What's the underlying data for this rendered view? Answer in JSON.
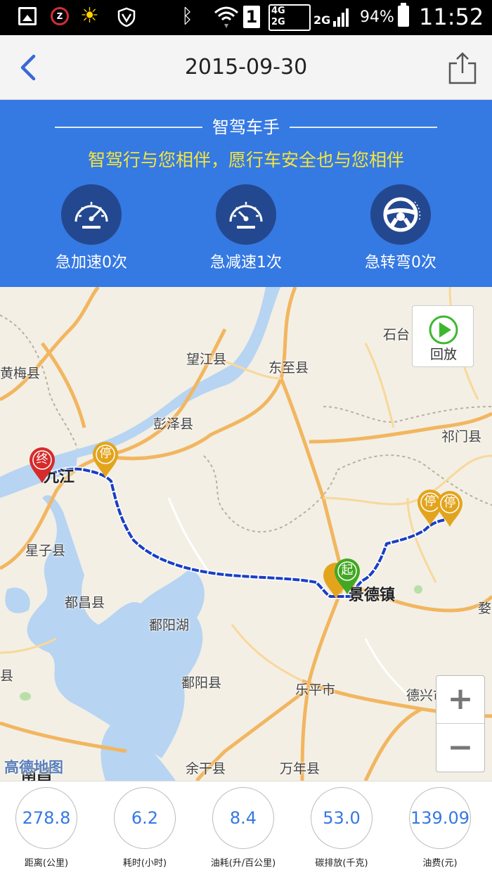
{
  "status_bar": {
    "sim_slot": "1",
    "network_4g": "4G",
    "network_2g_top": "2G",
    "network_2g": "2G",
    "battery_percent": "94%",
    "time": "11:52",
    "zapp_letter": "Z"
  },
  "header": {
    "title": "2015-09-30"
  },
  "banner": {
    "title": "智驾车手",
    "slogan": "智驾行与您相伴，愿行车安全也与您相伴",
    "stats": [
      {
        "label": "急加速0次",
        "icon": "speedometer-icon"
      },
      {
        "label": "急减速1次",
        "icon": "speedometer-icon"
      },
      {
        "label": "急转弯0次",
        "icon": "steering-wheel-icon"
      }
    ]
  },
  "map": {
    "replay_label": "回放",
    "zoom_in": "+",
    "zoom_out": "−",
    "logo": "高德地图",
    "labels": {
      "huangmei": "黄梅县",
      "wangjiang": "望江县",
      "dongzhi": "东至县",
      "shitai": "石台",
      "pengze": "彭泽县",
      "qimen": "祁门县",
      "jiujiang": "九江",
      "xingzi": "星子县",
      "duchang": "都昌县",
      "jingdezhen": "景德镇",
      "poyanghu": "鄱阳湖",
      "poyang": "鄱阳县",
      "leping": "乐平市",
      "dexing": "德兴市",
      "yugan": "余干县",
      "wannian": "万年县",
      "nanchang": "南昌",
      "edge_xian": "县",
      "edge_wu": "婺"
    },
    "markers": {
      "start": "起",
      "end": "终",
      "stop": "停"
    },
    "colors": {
      "route": "#1a3fc4",
      "start_marker": "#43a723",
      "end_marker": "#d52b2b",
      "stop_marker": "#e3a41d"
    }
  },
  "summary": [
    {
      "value": "278.8",
      "label": "距离(公里)"
    },
    {
      "value": "6.2",
      "label": "耗时(小时)"
    },
    {
      "value": "8.4",
      "label": "油耗(升/百公里)"
    },
    {
      "value": "53.0",
      "label": "碳排放(千克)"
    },
    {
      "value": "139.09",
      "label": "油费(元)"
    }
  ]
}
